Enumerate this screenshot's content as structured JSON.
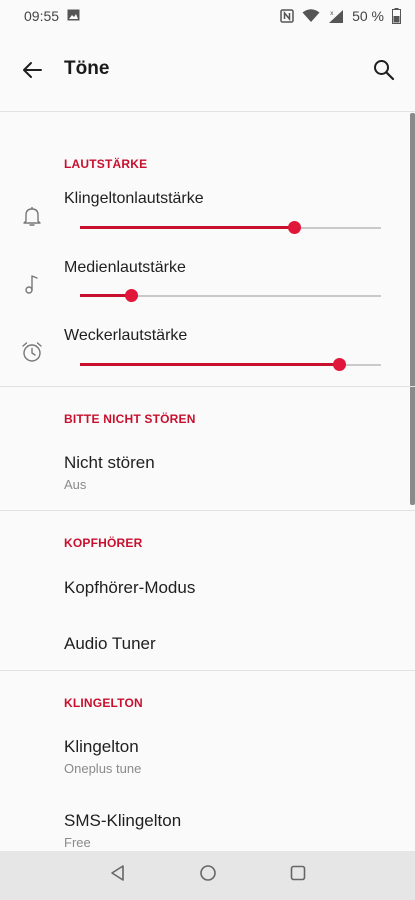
{
  "status_bar": {
    "time": "09:55",
    "battery": "50 %",
    "icons": [
      "image-notification-icon",
      "nfc-icon",
      "wifi-icon",
      "signal-icon",
      "battery-icon"
    ]
  },
  "app_bar": {
    "title": "Töne",
    "back_icon": "arrow-back-icon",
    "search_icon": "search-icon"
  },
  "volume_section": {
    "header": "LAUTSTÄRKE",
    "sliders": [
      {
        "label": "Klingeltonlautstärke",
        "icon": "bell-icon",
        "level": 0.71
      },
      {
        "label": "Medienlautstärke",
        "icon": "music-note-icon",
        "level": 0.17
      },
      {
        "label": "Weckerlautstärke",
        "icon": "alarm-clock-icon",
        "level": 0.86
      }
    ]
  },
  "dnd_section": {
    "header": "BITTE NICHT STÖREN",
    "items": [
      {
        "title": "Nicht stören",
        "subtitle": "Aus"
      }
    ]
  },
  "headphone_section": {
    "header": "KOPFHÖRER",
    "items": [
      {
        "title": "Kopfhörer-Modus"
      },
      {
        "title": "Audio Tuner"
      }
    ]
  },
  "ringtone_section": {
    "header": "KLINGELTON",
    "items": [
      {
        "title": "Klingelton",
        "subtitle": "Oneplus tune"
      },
      {
        "title": "SMS-Klingelton",
        "subtitle": "Free"
      }
    ]
  },
  "colors": {
    "accent": "#c8102e",
    "slider_thumb": "#e0173a",
    "track": "#c9c9c9",
    "background": "#fafafa",
    "nav_bar": "#e6e6e6"
  },
  "nav_bar": {
    "buttons": [
      "back-triangle-icon",
      "home-circle-icon",
      "recents-square-icon"
    ]
  }
}
